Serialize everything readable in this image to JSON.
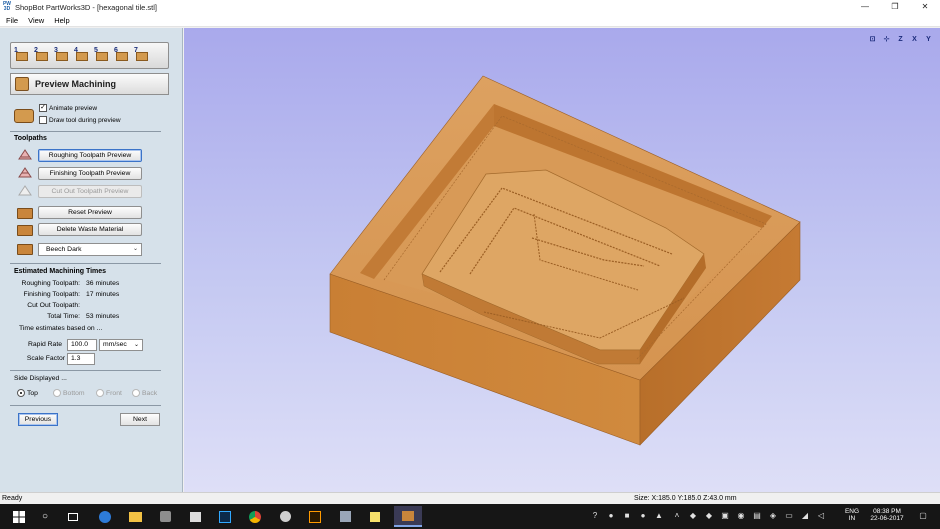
{
  "window": {
    "app_icon_text": "PW 3D",
    "title": "ShopBot PartWorks3D - [hexagonal tile.stl]",
    "controls": {
      "minimize": "—",
      "maximize": "❐",
      "close": "✕"
    }
  },
  "menu": {
    "items": [
      "File",
      "View",
      "Help"
    ]
  },
  "panel": {
    "steps": [
      "1",
      "2",
      "3",
      "4",
      "5",
      "6",
      "7"
    ],
    "header_title": "Preview Machining",
    "animate_preview": {
      "label": "Animate preview",
      "checked": true
    },
    "draw_tool": {
      "label": "Draw tool during preview",
      "checked": false
    },
    "toolpaths": {
      "title": "Toolpaths",
      "roughing_button": "Roughing Toolpath Preview",
      "finishing_button": "Finishing Toolpath Preview",
      "cutout_button": "Cut Out Toolpath Preview"
    },
    "reset_button": "Reset Preview",
    "delete_button": "Delete Waste Material",
    "material": {
      "value": "Beech Dark"
    },
    "times": {
      "title": "Estimated Machining Times",
      "roughing_label": "Roughing Toolpath:",
      "roughing_value": "36 minutes",
      "finishing_label": "Finishing Toolpath:",
      "finishing_value": "17 minutes",
      "cutout_label": "Cut Out Toolpath:",
      "cutout_value": "",
      "total_label": "Total Time:",
      "total_value": "53 minutes",
      "based_on": "Time estimates based on ..."
    },
    "rapid_rate": {
      "label": "Rapid Rate",
      "value": "100.0",
      "unit": "mm/sec"
    },
    "scale_factor": {
      "label": "Scale Factor",
      "value": "1.3"
    },
    "side": {
      "title": "Side Displayed ...",
      "top": "Top",
      "bottom": "Bottom",
      "front": "Front",
      "back": "Back",
      "selected": "Top"
    },
    "previous_button": "Previous",
    "next_button": "Next"
  },
  "viewport": {
    "tools": [
      "⊡",
      "⊹",
      "Z",
      "X",
      "Y"
    ]
  },
  "status": {
    "left": "Ready",
    "right": "Size: X:185.0 Y:185.0 Z:43.0 mm"
  },
  "taskbar": {
    "search_icon": "○",
    "lang_line1": "ENG",
    "lang_line2": "IN",
    "time": "08:38 PM",
    "date": "22-06-2017"
  },
  "colors": {
    "wood": "#c9853b",
    "viewport_top": "#a9a9ec",
    "viewport_bottom": "#dedff7",
    "panel": "#d6e1ea"
  }
}
